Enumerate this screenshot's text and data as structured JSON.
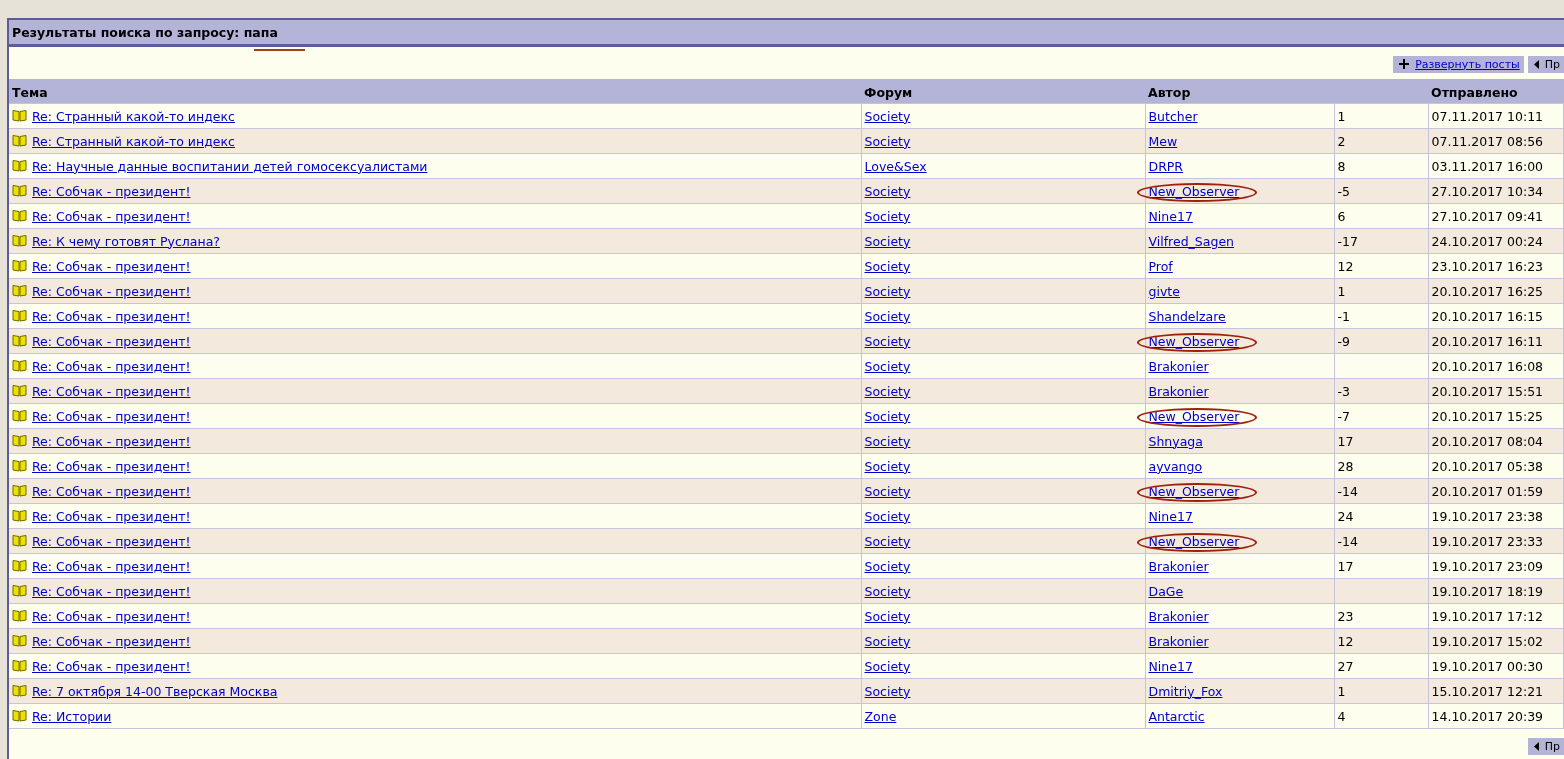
{
  "title": "Результаты поиска по запросу: папа",
  "title_marked": true,
  "toolbar": {
    "expand": "Развернуть посты",
    "prev": "Пр"
  },
  "table": {
    "columns": [
      "Тема",
      "Форум",
      "Автор",
      "",
      "Отправлено"
    ],
    "rows": [
      {
        "topic": "Re: Странный какой-то индекс",
        "forum": "Society",
        "author": "Butcher",
        "score": "1",
        "date": "07.11.2017 10:11",
        "circled": false
      },
      {
        "topic": "Re: Странный какой-то индекс",
        "forum": "Society",
        "author": "Mew",
        "score": "2",
        "date": "07.11.2017 08:56",
        "circled": false
      },
      {
        "topic": "Re: Научные данные воспитании детей гомосексуалистами",
        "forum": "Love&Sex",
        "author": "DRPR",
        "score": "8",
        "date": "03.11.2017 16:00",
        "circled": false
      },
      {
        "topic": "Re: Собчак - президент!",
        "forum": "Society",
        "author": "New_Observer",
        "score": "-5",
        "date": "27.10.2017 10:34",
        "circled": true
      },
      {
        "topic": "Re: Собчак - президент!",
        "forum": "Society",
        "author": "Nine17",
        "score": "6",
        "date": "27.10.2017 09:41",
        "circled": false
      },
      {
        "topic": "Re: К чему готовят Руслана?",
        "forum": "Society",
        "author": "Vilfred_Sagen",
        "score": "-17",
        "date": "24.10.2017 00:24",
        "circled": false
      },
      {
        "topic": "Re: Собчак - президент!",
        "forum": "Society",
        "author": "Prof",
        "score": "12",
        "date": "23.10.2017 16:23",
        "circled": false
      },
      {
        "topic": "Re: Собчак - президент!",
        "forum": "Society",
        "author": "givte",
        "score": "1",
        "date": "20.10.2017 16:25",
        "circled": false
      },
      {
        "topic": "Re: Собчак - президент!",
        "forum": "Society",
        "author": "Shandelzare",
        "score": "-1",
        "date": "20.10.2017 16:15",
        "circled": false
      },
      {
        "topic": "Re: Собчак - президент!",
        "forum": "Society",
        "author": "New_Observer",
        "score": "-9",
        "date": "20.10.2017 16:11",
        "circled": true
      },
      {
        "topic": "Re: Собчак - президент!",
        "forum": "Society",
        "author": "Brakonier",
        "score": "",
        "date": "20.10.2017 16:08",
        "circled": false
      },
      {
        "topic": "Re: Собчак - президент!",
        "forum": "Society",
        "author": "Brakonier",
        "score": "-3",
        "date": "20.10.2017 15:51",
        "circled": false
      },
      {
        "topic": "Re: Собчак - президент!",
        "forum": "Society",
        "author": "New_Observer",
        "score": "-7",
        "date": "20.10.2017 15:25",
        "circled": true
      },
      {
        "topic": "Re: Собчак - президент!",
        "forum": "Society",
        "author": "Shnyaga",
        "score": "17",
        "date": "20.10.2017 08:04",
        "circled": false
      },
      {
        "topic": "Re: Собчак - президент!",
        "forum": "Society",
        "author": "ayvango",
        "score": "28",
        "date": "20.10.2017 05:38",
        "circled": false
      },
      {
        "topic": "Re: Собчак - президент!",
        "forum": "Society",
        "author": "New_Observer",
        "score": "-14",
        "date": "20.10.2017 01:59",
        "circled": true
      },
      {
        "topic": "Re: Собчак - президент!",
        "forum": "Society",
        "author": "Nine17",
        "score": "24",
        "date": "19.10.2017 23:38",
        "circled": false
      },
      {
        "topic": "Re: Собчак - президент!",
        "forum": "Society",
        "author": "New_Observer",
        "score": "-14",
        "date": "19.10.2017 23:33",
        "circled": true
      },
      {
        "topic": "Re: Собчак - президент!",
        "forum": "Society",
        "author": "Brakonier",
        "score": "17",
        "date": "19.10.2017 23:09",
        "circled": false
      },
      {
        "topic": "Re: Собчак - президент!",
        "forum": "Society",
        "author": "DaGe",
        "score": "",
        "date": "19.10.2017 18:19",
        "circled": false
      },
      {
        "topic": "Re: Собчак - президент!",
        "forum": "Society",
        "author": "Brakonier",
        "score": "23",
        "date": "19.10.2017 17:12",
        "circled": false
      },
      {
        "topic": "Re: Собчак - президент!",
        "forum": "Society",
        "author": "Brakonier",
        "score": "12",
        "date": "19.10.2017 15:02",
        "circled": false
      },
      {
        "topic": "Re: Собчак - президент!",
        "forum": "Society",
        "author": "Nine17",
        "score": "27",
        "date": "19.10.2017 00:30",
        "circled": false
      },
      {
        "topic": "Re: 7 октября 14-00 Тверская Москва",
        "forum": "Society",
        "author": "Dmitriy_Fox",
        "score": "1",
        "date": "15.10.2017 12:21",
        "circled": false
      },
      {
        "topic": "Re: Истории",
        "forum": "Zone",
        "author": "Antarctic",
        "score": "4",
        "date": "14.10.2017 20:39",
        "circled": false
      }
    ]
  },
  "footer": {
    "prev": "Пр"
  }
}
